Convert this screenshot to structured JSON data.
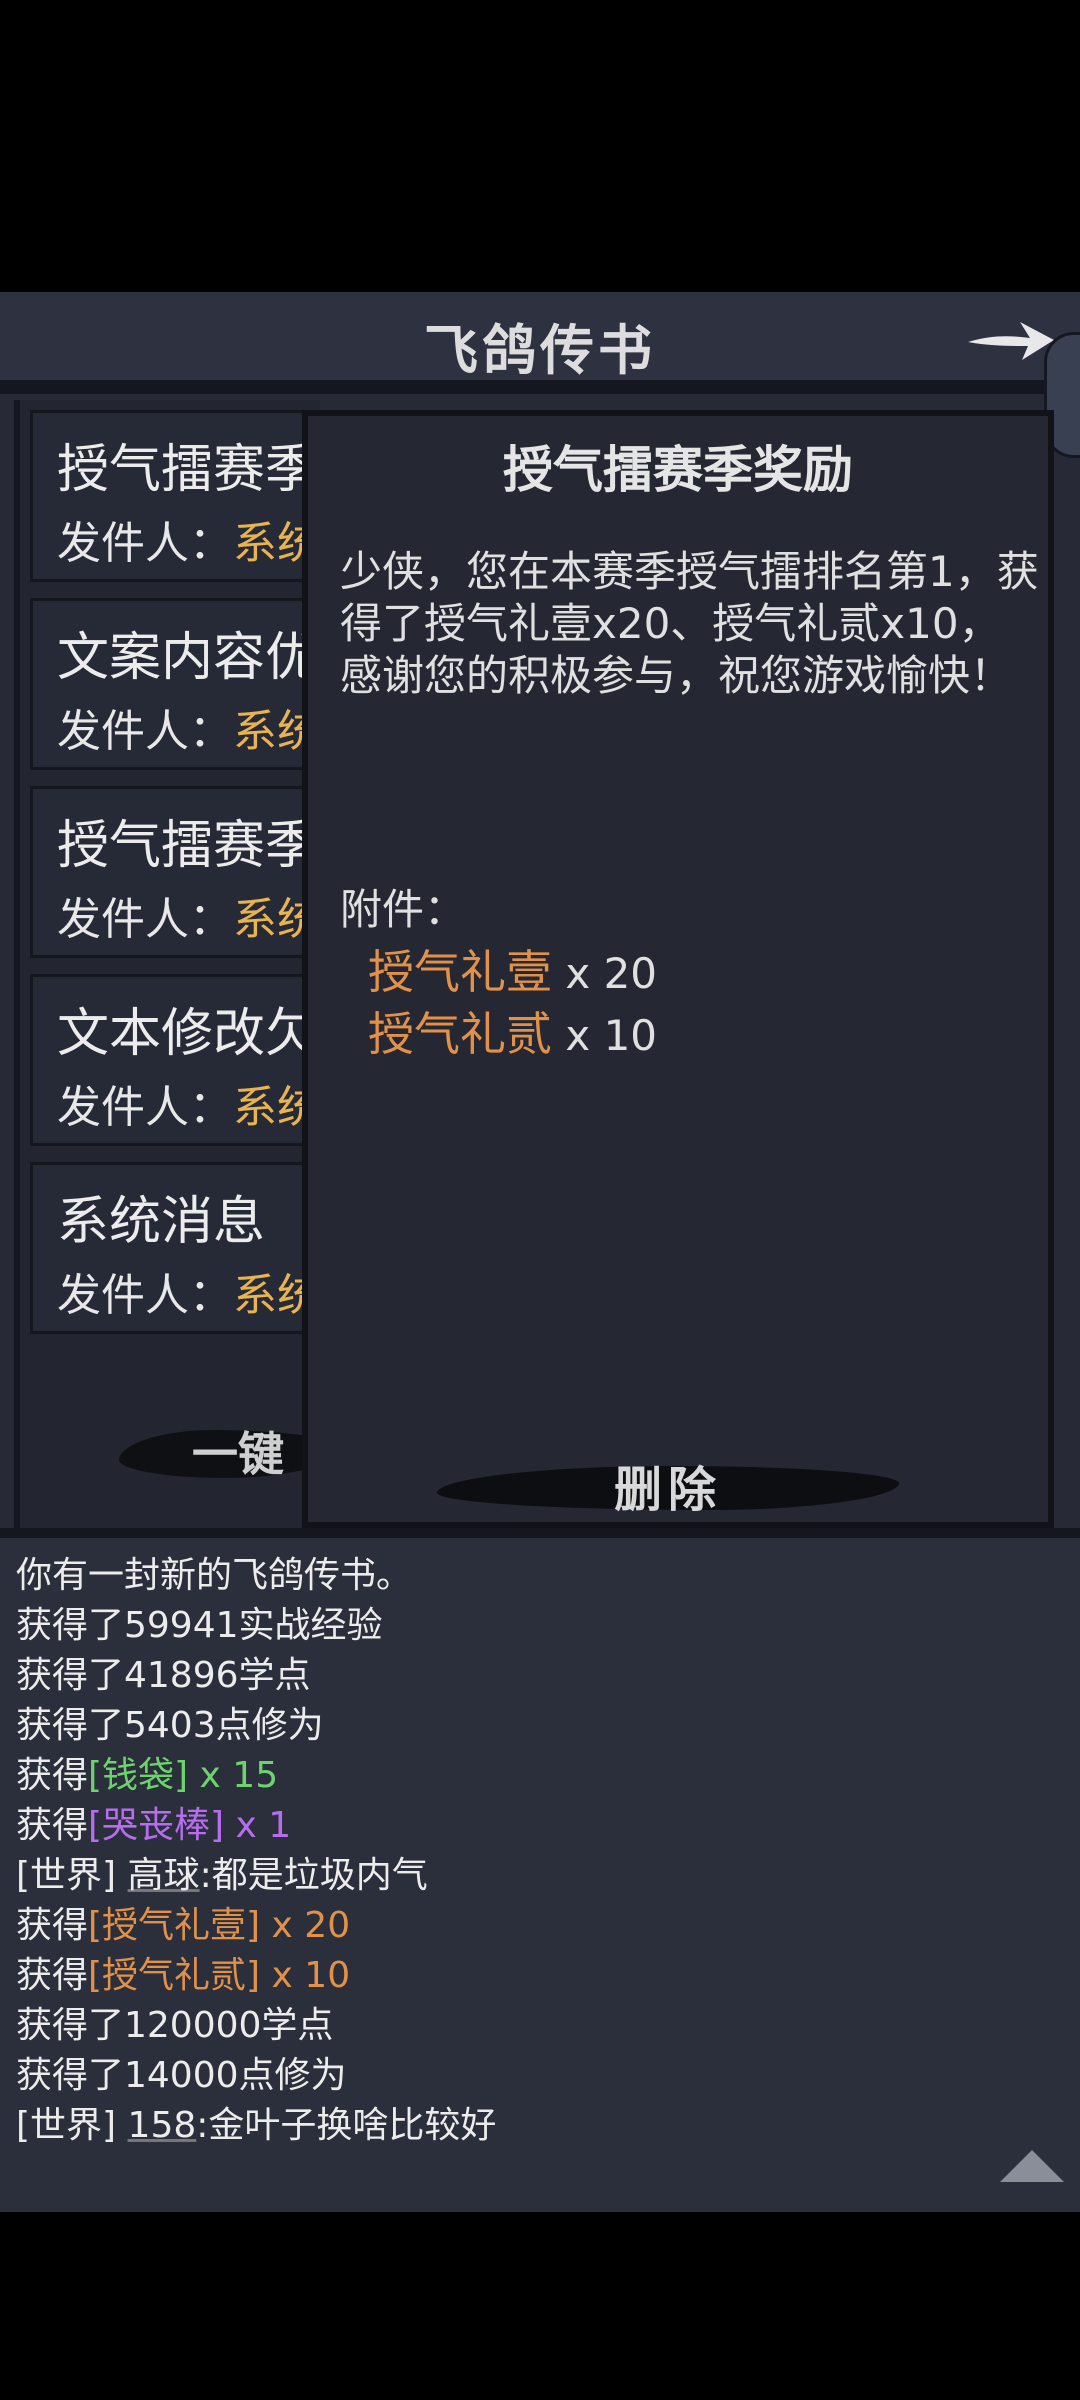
{
  "header": {
    "title": "飞鸽传书"
  },
  "mail_list": {
    "items": [
      {
        "title": "授气擂赛季",
        "sender_label": "发件人：",
        "sender_value": "系统"
      },
      {
        "title": "文案内容优",
        "sender_label": "发件人：",
        "sender_value": "系统"
      },
      {
        "title": "授气擂赛季",
        "sender_label": "发件人：",
        "sender_value": "系统"
      },
      {
        "title": "文本修改欠",
        "sender_label": "发件人：",
        "sender_value": "系统"
      },
      {
        "title": "系统消息",
        "sender_label": "发件人：",
        "sender_value": "系统"
      }
    ],
    "one_key_label": "一键"
  },
  "detail": {
    "title": "授气擂赛季奖励",
    "body": "少侠，您在本赛季授气擂排名第1，获得了授气礼壹x20、授气礼贰x10，感谢您的积极参与，祝您游戏愉快！",
    "attachments_label": "附件：",
    "attachments": [
      {
        "name": "授气礼壹",
        "qty": "x 20"
      },
      {
        "name": "授气礼贰",
        "qty": "x 10"
      }
    ],
    "delete_label": "删除"
  },
  "log": {
    "lines": [
      {
        "text": "你有一封新的飞鸽传书。"
      },
      {
        "text": "获得了59941实战经验"
      },
      {
        "text": "获得了41896学点"
      },
      {
        "text": "获得了5403点修为"
      },
      {
        "prefix": "获得",
        "item": "[钱袋] x 15",
        "color": "green"
      },
      {
        "prefix": "获得",
        "item": "[哭丧棒] x 1",
        "color": "purple"
      },
      {
        "channel": "[世界]",
        "user": "高球",
        "message": ":都是垃圾内气"
      },
      {
        "prefix": "获得",
        "item": "[授气礼壹] x 20",
        "color": "orange"
      },
      {
        "prefix": "获得",
        "item": "[授气礼贰] x 10",
        "color": "orange"
      },
      {
        "text": "获得了120000学点"
      },
      {
        "text": "获得了14000点修为"
      },
      {
        "channel": "[世界]",
        "user": "158",
        "message": ":金叶子换啥比较好"
      }
    ]
  }
}
